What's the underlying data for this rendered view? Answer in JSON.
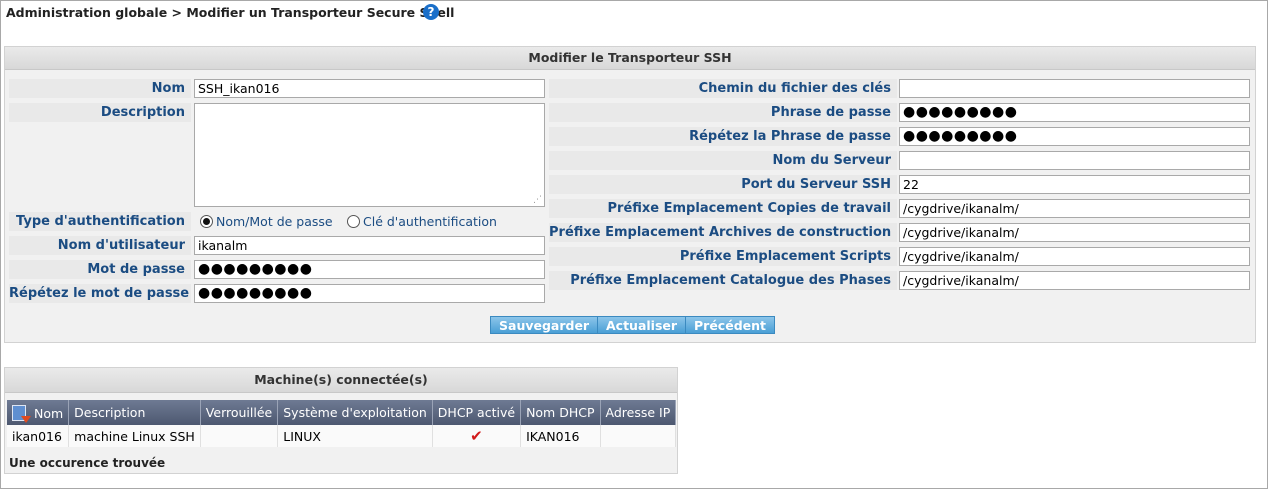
{
  "breadcrumb": "Administration globale > Modifier un Transporteur Secure Shell",
  "help_icon": "?",
  "form": {
    "title": "Modifier le Transporteur SSH",
    "left": {
      "name_label": "Nom",
      "name_value": "SSH_ikan016",
      "description_label": "Description",
      "description_value": "",
      "auth_type_label": "Type d'authentification",
      "auth_options": [
        "Nom/Mot de passe",
        "Clé d'authentification"
      ],
      "auth_selected": "Nom/Mot de passe",
      "username_label": "Nom d'utilisateur",
      "username_value": "ikanalm",
      "password_label": "Mot de passe",
      "password_value": "●●●●●●●●●",
      "password_repeat_label": "Répétez le mot de passe",
      "password_repeat_value": "●●●●●●●●●"
    },
    "right": {
      "key_path_label": "Chemin du fichier des clés",
      "key_path_value": "",
      "passphrase_label": "Phrase de passe",
      "passphrase_value": "●●●●●●●●●",
      "passphrase_repeat_label": "Répétez la Phrase de passe",
      "passphrase_repeat_value": "●●●●●●●●●",
      "server_name_label": "Nom du Serveur",
      "server_name_value": "",
      "ssh_port_label": "Port du Serveur SSH",
      "ssh_port_value": "22",
      "prefix_workcopies_label": "Préfixe Emplacement Copies de travail",
      "prefix_workcopies_value": "/cygdrive/ikanalm/",
      "prefix_archives_label": "Préfixe Emplacement Archives de construction",
      "prefix_archives_value": "/cygdrive/ikanalm/",
      "prefix_scripts_label": "Préfixe Emplacement Scripts",
      "prefix_scripts_value": "/cygdrive/ikanalm/",
      "prefix_catalog_label": "Préfixe Emplacement Catalogue des Phases",
      "prefix_catalog_value": "/cygdrive/ikanalm/"
    },
    "buttons": {
      "save": "Sauvegarder",
      "refresh": "Actualiser",
      "back": "Précédent"
    }
  },
  "machines": {
    "title": "Machine(s) connectée(s)",
    "columns": [
      "Nom",
      "Description",
      "Verrouillée",
      "Système d'exploitation",
      "DHCP activé",
      "Nom DHCP",
      "Adresse IP"
    ],
    "rows": [
      {
        "name": "ikan016",
        "description": "machine Linux SSH",
        "locked": "",
        "os": "LINUX",
        "dhcp": "✔",
        "dhcp_name": "IKAN016",
        "ip": ""
      }
    ],
    "footer": "Une occurence trouvée"
  },
  "colors": {
    "label_text": "#1b4c82",
    "button": "#4a9fd5",
    "table_header": "#5a657c",
    "check": "#d21a1a"
  }
}
